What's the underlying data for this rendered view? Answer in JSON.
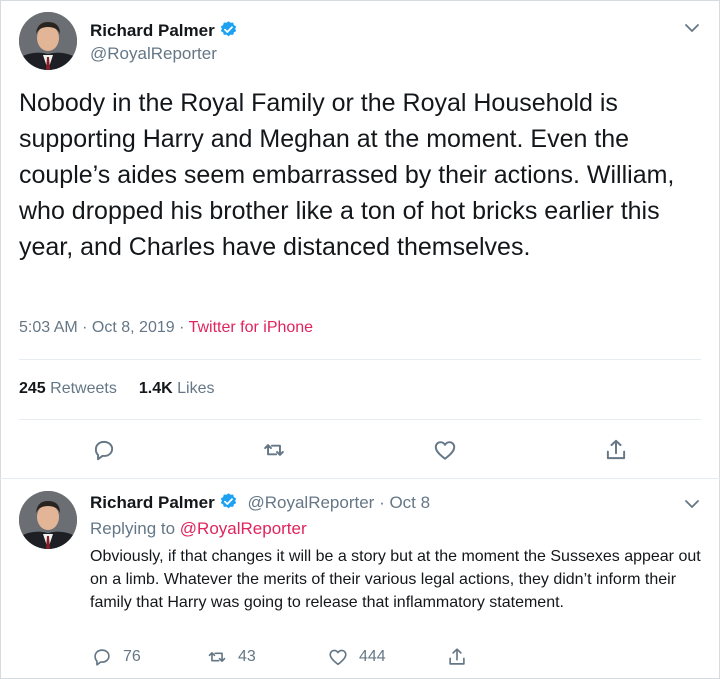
{
  "tweet": {
    "author_name": "Richard Palmer",
    "author_handle": "@RoyalReporter",
    "text": "Nobody in the Royal Family or the Royal Household is supporting Harry and Meghan at the moment. Even the couple’s aides seem embarrassed by their actions. William, who dropped his brother like a ton of hot bricks earlier this year, and Charles have distanced themselves.",
    "timestamp": "5:03 AM · Oct 8, 2019 · ",
    "source": "Twitter for iPhone",
    "retweets_count": "245",
    "retweets_label": "Retweets",
    "likes_count": "1.4K",
    "likes_label": "Likes",
    "actions": [
      "reply-icon",
      "retweet-icon",
      "like-icon",
      "share-icon"
    ]
  },
  "reply": {
    "author_name": "Richard Palmer",
    "author_handle": "@RoyalReporter",
    "date": " · Oct 8",
    "replying_prefix": "Replying to ",
    "replying_to": "@RoyalReporter",
    "text": "Obviously, if that changes it will be a story but at the moment the Sussexes appear out on a limb. Whatever the merits of their various legal actions, they didn’t inform their family that Harry was going to release that inflammatory statement.",
    "reply_count": "76",
    "retweet_count": "43",
    "like_count": "444"
  },
  "colors": {
    "text": "#14171a",
    "secondary": "#657786",
    "accent_link": "#e0245e",
    "verified": "#1da1f2",
    "divider": "#e6ecf0"
  }
}
